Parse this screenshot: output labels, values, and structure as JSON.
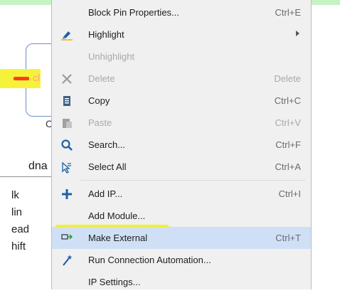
{
  "canvas": {
    "pin_label": "cl",
    "block_name_fragment": "C",
    "tab_label": "dna",
    "side_list": [
      "lk",
      "lin",
      "ead",
      "hift"
    ]
  },
  "menu": {
    "items": [
      {
        "label": "Block Pin Properties...",
        "shortcut": "Ctrl+E",
        "icon": "",
        "disabled": false
      },
      {
        "label": "Highlight",
        "shortcut": "",
        "icon": "highlighter-icon",
        "disabled": false,
        "submenu": true
      },
      {
        "label": "Unhighlight",
        "shortcut": "",
        "icon": "",
        "disabled": true
      },
      {
        "label": "Delete",
        "shortcut": "Delete",
        "icon": "delete-x-icon",
        "disabled": true
      },
      {
        "label": "Copy",
        "shortcut": "Ctrl+C",
        "icon": "copy-icon",
        "disabled": false
      },
      {
        "label": "Paste",
        "shortcut": "Ctrl+V",
        "icon": "paste-icon",
        "disabled": true
      },
      {
        "label": "Search...",
        "shortcut": "Ctrl+F",
        "icon": "search-icon",
        "disabled": false
      },
      {
        "label": "Select All",
        "shortcut": "Ctrl+A",
        "icon": "select-all-icon",
        "disabled": false
      },
      {
        "label": "Add IP...",
        "shortcut": "Ctrl+I",
        "icon": "plus-icon",
        "disabled": false
      },
      {
        "label": "Add Module...",
        "shortcut": "",
        "icon": "",
        "disabled": false
      },
      {
        "label": "Make External",
        "shortcut": "Ctrl+T",
        "icon": "make-external-icon",
        "disabled": false,
        "selected": true
      },
      {
        "label": "Run Connection Automation...",
        "shortcut": "",
        "icon": "wand-icon",
        "disabled": false
      },
      {
        "label": "IP Settings...",
        "shortcut": "",
        "icon": "",
        "disabled": false
      }
    ]
  },
  "colors": {
    "selection": "#cfe0f6",
    "highlight_marker": "#f4f21c",
    "pin_red": "#ff3b1f",
    "icon_blue": "#1f5fa8"
  }
}
